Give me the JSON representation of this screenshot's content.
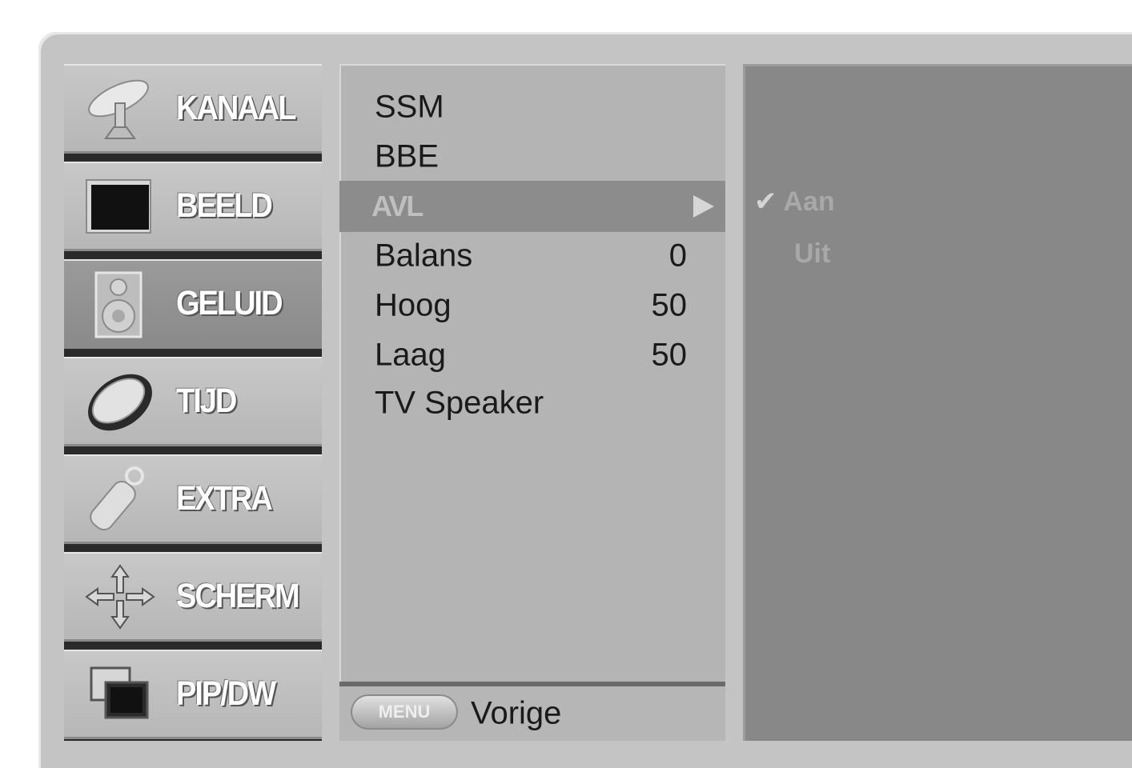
{
  "sidebar": {
    "items": [
      {
        "label": "KANAAL",
        "icon": "satellite-dish-icon",
        "active": false
      },
      {
        "label": "BEELD",
        "icon": "picture-screen-icon",
        "active": false
      },
      {
        "label": "GELUID",
        "icon": "speaker-icon",
        "active": true
      },
      {
        "label": "TIJD",
        "icon": "clock-icon",
        "active": false
      },
      {
        "label": "EXTRA",
        "icon": "remote-tag-icon",
        "active": false
      },
      {
        "label": "SCHERM",
        "icon": "move-arrows-icon",
        "active": false
      },
      {
        "label": "PIP/DW",
        "icon": "pip-windows-icon",
        "active": false
      }
    ]
  },
  "submenu": {
    "items": [
      {
        "label": "SSM",
        "value": ""
      },
      {
        "label": "BBE",
        "value": ""
      },
      {
        "label": "AVL",
        "value": "",
        "selected": true
      },
      {
        "label": "Balans",
        "value": "0"
      },
      {
        "label": "Hoog",
        "value": "50"
      },
      {
        "label": "Laag",
        "value": "50"
      },
      {
        "label": "TV Speaker",
        "value": ""
      }
    ],
    "footer": {
      "button_label": "MENU",
      "back_label": "Vorige"
    }
  },
  "options": {
    "items": [
      {
        "label": "Aan",
        "checked": true
      },
      {
        "label": "Uit",
        "checked": false
      }
    ],
    "check_glyph": "✔"
  }
}
